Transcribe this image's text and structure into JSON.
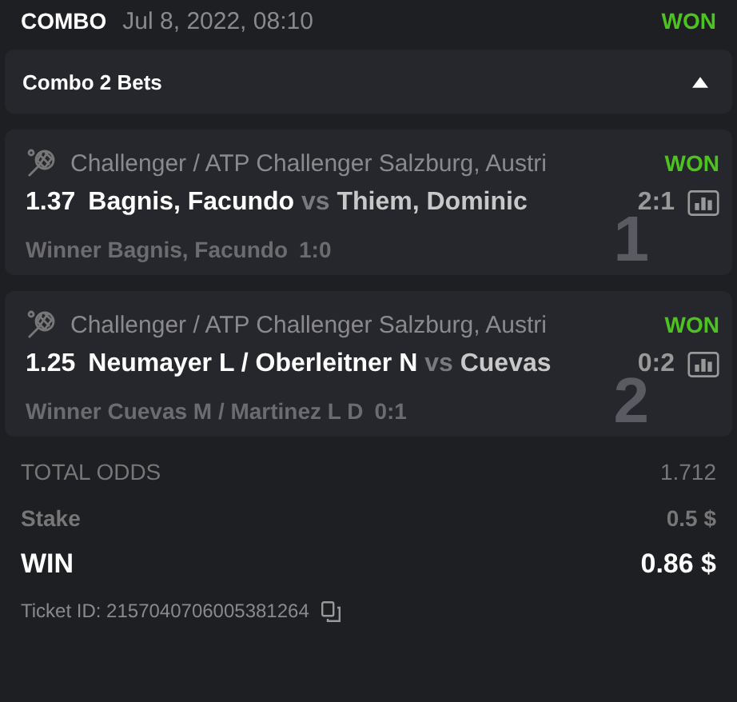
{
  "header": {
    "type": "COMBO",
    "date": "Jul 8, 2022, 08:10",
    "result": "WON"
  },
  "group": {
    "title": "Combo 2 Bets",
    "expanded": true
  },
  "bets": [
    {
      "index": "1",
      "league": "Challenger / ATP Challenger Salzburg, Austri",
      "result": "WON",
      "odds": "1.37",
      "home": "Bagnis, Facundo",
      "vs": "vs",
      "away": "Thiem, Dominic",
      "score": "2:1",
      "pick": "Winner Bagnis, Facundo",
      "pick_score": "1:0"
    },
    {
      "index": "2",
      "league": "Challenger / ATP Challenger Salzburg, Austri",
      "result": "WON",
      "odds": "1.25",
      "home": "Neumayer L / Oberleitner N",
      "vs": "vs",
      "away": "Cuevas",
      "score": "0:2",
      "pick": "Winner Cuevas M / Martinez L D",
      "pick_score": "0:1"
    }
  ],
  "summary": {
    "total_odds_label": "TOTAL ODDS",
    "total_odds": "1.712",
    "stake_label": "Stake",
    "stake": "0.5 $",
    "win_label": "WIN",
    "win": "0.86 $"
  },
  "ticket": "Ticket ID: 2157040706005381264"
}
